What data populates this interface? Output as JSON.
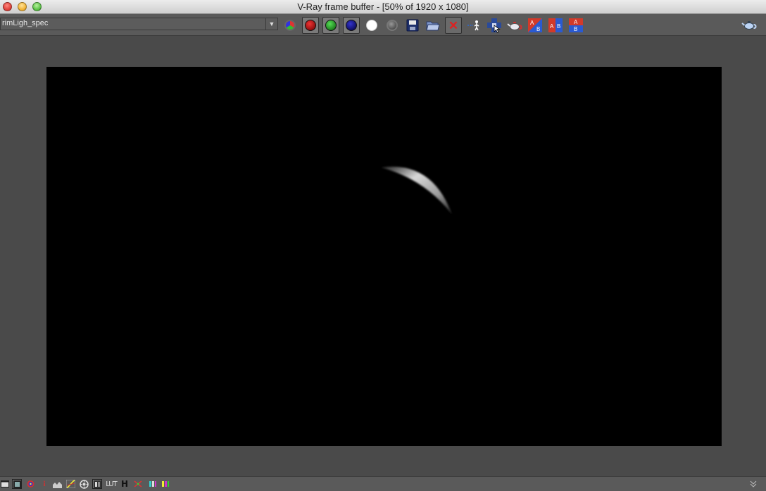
{
  "window": {
    "title": "V-Ray frame buffer - [50% of 1920 x 1080]"
  },
  "toolbar": {
    "channel_value": "rimLigh_spec",
    "buttons": [
      {
        "icon": "rgb-channels-icon"
      },
      {
        "icon": "red-channel-icon"
      },
      {
        "icon": "green-channel-icon"
      },
      {
        "icon": "blue-channel-icon"
      },
      {
        "icon": "alpha-channel-icon"
      },
      {
        "icon": "mono-icon"
      },
      {
        "icon": "save-icon"
      },
      {
        "icon": "open-icon"
      },
      {
        "icon": "clear-icon"
      },
      {
        "icon": "track-mouse-icon"
      },
      {
        "icon": "region-render-icon"
      },
      {
        "icon": "render-teapot-icon"
      },
      {
        "icon": "ab-diagonal-icon"
      },
      {
        "icon": "ab-horizontal-icon"
      },
      {
        "icon": "ab-vertical-icon"
      }
    ],
    "right_icon": "teapot-icon"
  },
  "statusbar": {
    "info_label": "i",
    "lut_label": "LUT",
    "h_label": "H"
  },
  "colors": {
    "background": "#4a4a4a",
    "toolbar": "#5a5a5a",
    "canvas": "#000000",
    "crescent": "#d8d8d8"
  }
}
